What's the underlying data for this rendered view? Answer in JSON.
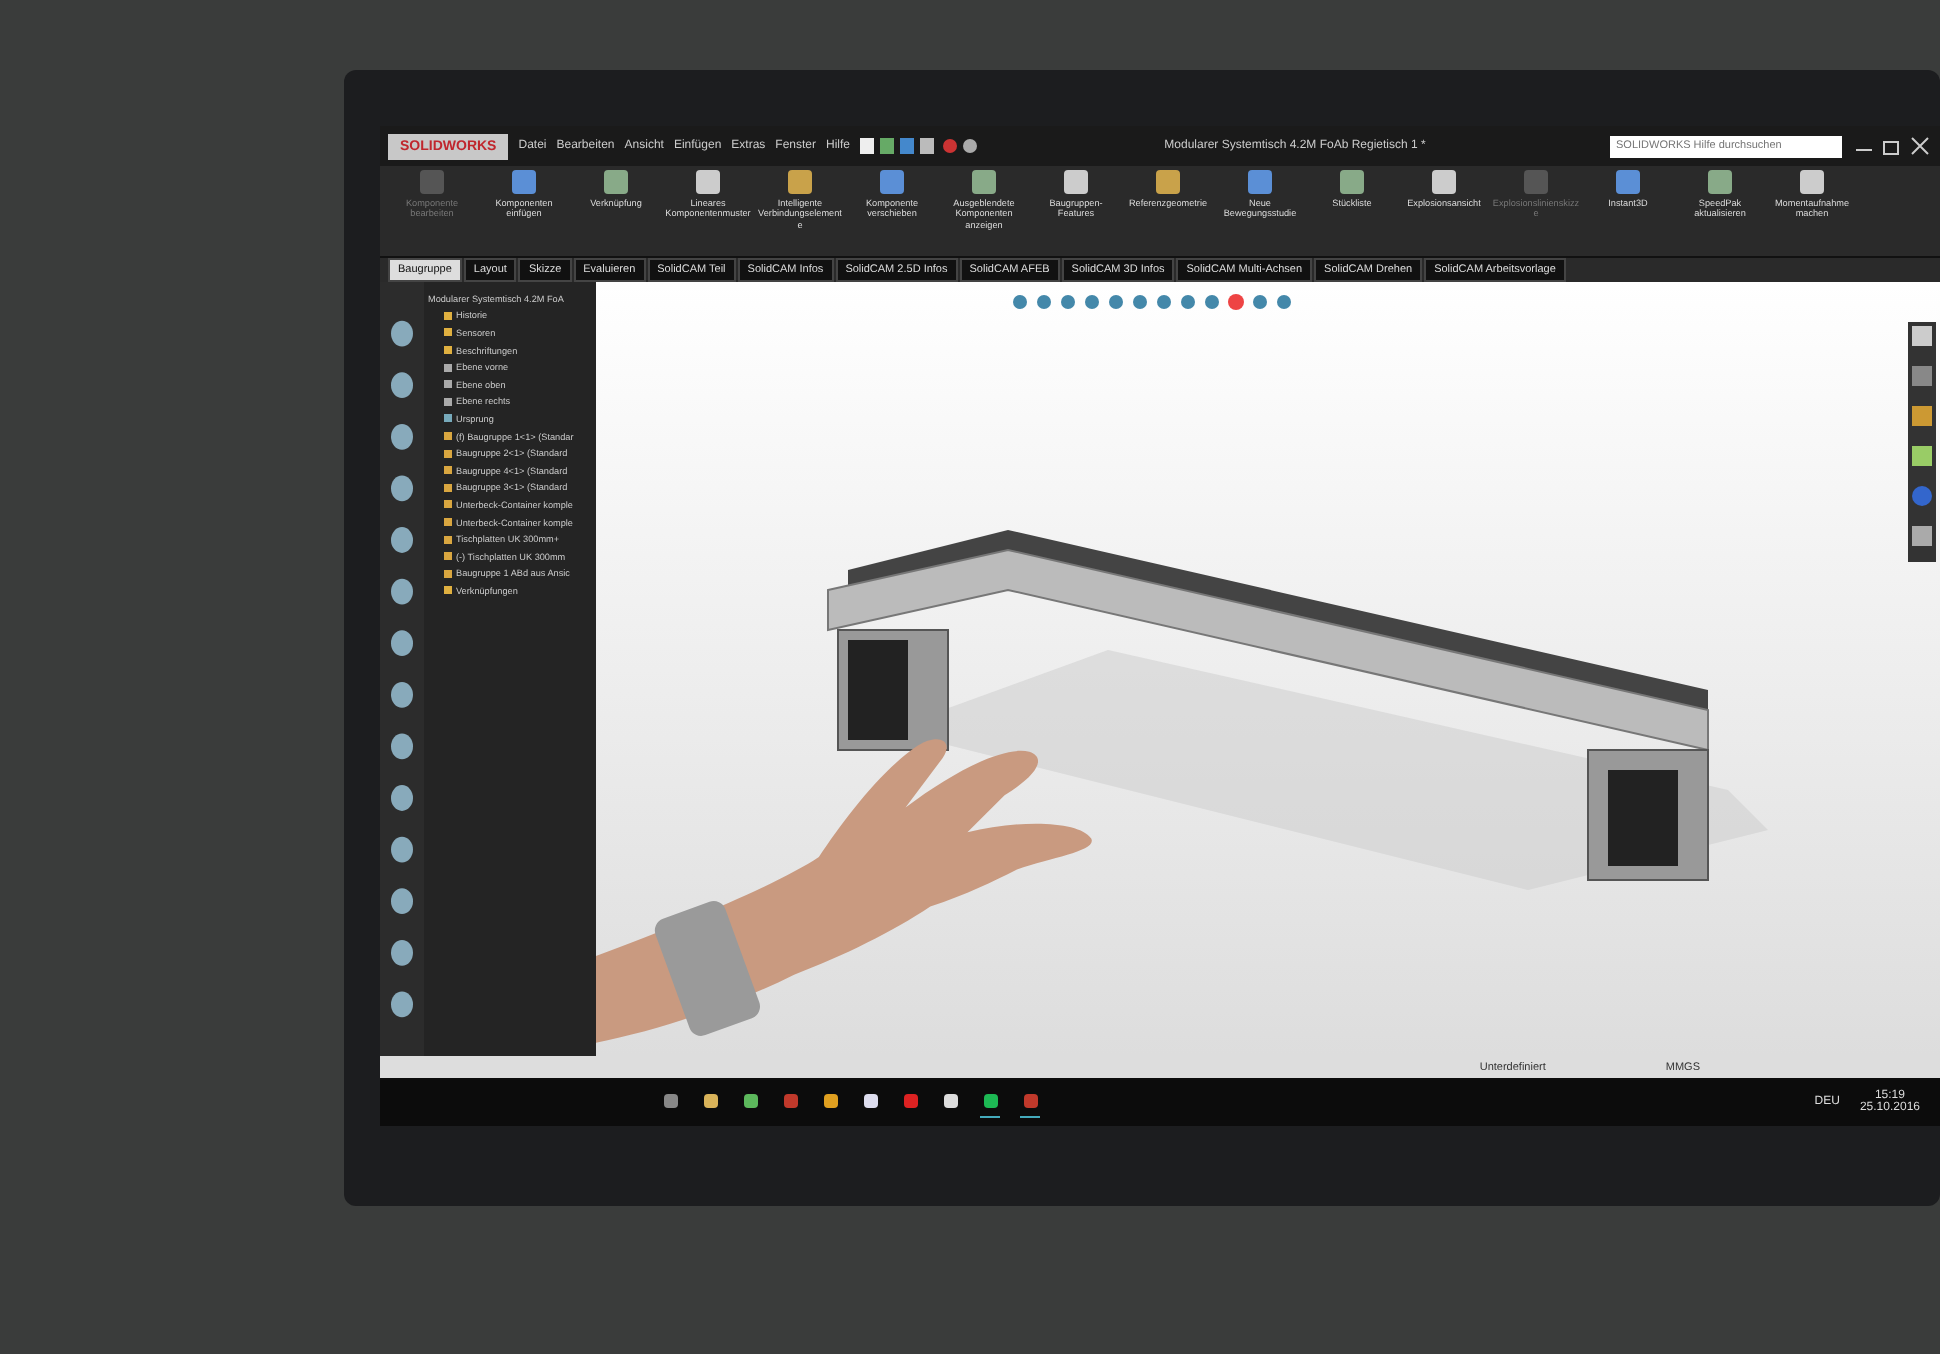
{
  "app": {
    "logo": "SOLIDWORKS",
    "menu": [
      "Datei",
      "Bearbeiten",
      "Ansicht",
      "Einfügen",
      "Extras",
      "Fenster",
      "Hilfe"
    ],
    "title": "Modularer Systemtisch 4.2M FoAb Regietisch 1 *",
    "search": {
      "placeholder": "SOLIDWORKS Hilfe durchsuchen"
    }
  },
  "ribbon": [
    {
      "label": "Komponente bearbeiten",
      "disabled": true
    },
    {
      "label": "Komponenten einfügen",
      "disabled": false
    },
    {
      "label": "Verknüpfung",
      "disabled": false
    },
    {
      "label": "Lineares Komponentenmuster",
      "disabled": false
    },
    {
      "label": "Intelligente Verbindungselemente",
      "disabled": false
    },
    {
      "label": "Komponente verschieben",
      "disabled": false
    },
    {
      "label": "Ausgeblendete Komponenten anzeigen",
      "disabled": false
    },
    {
      "label": "Baugruppen-Features",
      "disabled": false
    },
    {
      "label": "Referenzgeometrie",
      "disabled": false
    },
    {
      "label": "Neue Bewegungsstudie",
      "disabled": false
    },
    {
      "label": "Stückliste",
      "disabled": false
    },
    {
      "label": "Explosionsansicht",
      "disabled": false
    },
    {
      "label": "Explosionslinienskizze",
      "disabled": true
    },
    {
      "label": "Instant3D",
      "disabled": false
    },
    {
      "label": "SpeedPak aktualisieren",
      "disabled": false
    },
    {
      "label": "Momentaufnahme machen",
      "disabled": false
    }
  ],
  "tabs": [
    {
      "label": "Baugruppe",
      "selected": true
    },
    {
      "label": "Layout",
      "selected": false
    },
    {
      "label": "Skizze",
      "selected": false
    },
    {
      "label": "Evaluieren",
      "selected": false
    },
    {
      "label": "SolidCAM Teil",
      "selected": false
    },
    {
      "label": "SolidCAM Infos",
      "selected": false
    },
    {
      "label": "SolidCAM 2.5D Infos",
      "selected": false
    },
    {
      "label": "SolidCAM AFEB",
      "selected": false
    },
    {
      "label": "SolidCAM 3D Infos",
      "selected": false
    },
    {
      "label": "SolidCAM Multi-Achsen",
      "selected": false
    },
    {
      "label": "SolidCAM Drehen",
      "selected": false
    },
    {
      "label": "SolidCAM Arbeitsvorlage",
      "selected": false
    }
  ],
  "tree": {
    "root": "Modularer Systemtisch 4.2M FoA",
    "children": [
      {
        "label": "Historie",
        "kind": "folder"
      },
      {
        "label": "Sensoren",
        "kind": "folder"
      },
      {
        "label": "Beschriftungen",
        "kind": "folder"
      },
      {
        "label": "Ebene vorne",
        "kind": "plane"
      },
      {
        "label": "Ebene oben",
        "kind": "plane"
      },
      {
        "label": "Ebene rechts",
        "kind": "plane"
      },
      {
        "label": "Ursprung",
        "kind": "origin"
      },
      {
        "label": "(f) Baugruppe 1<1> (Standar",
        "kind": "part"
      },
      {
        "label": "Baugruppe 2<1> (Standard",
        "kind": "part"
      },
      {
        "label": "Baugruppe 4<1> (Standard",
        "kind": "part"
      },
      {
        "label": "Baugruppe 3<1> (Standard",
        "kind": "part"
      },
      {
        "label": "Unterbeck-Container komple",
        "kind": "part"
      },
      {
        "label": "Unterbeck-Container komple",
        "kind": "part"
      },
      {
        "label": "Tischplatten UK 300mm+",
        "kind": "part"
      },
      {
        "label": "(-) Tischplatten UK 300mm",
        "kind": "part"
      },
      {
        "label": "Baugruppe 1 ABd aus Ansic",
        "kind": "part"
      },
      {
        "label": "Verknüpfungen",
        "kind": "folder"
      }
    ]
  },
  "status": {
    "state": "Unterdefiniert",
    "units": "MMGS"
  },
  "taskbar": {
    "apps": [
      {
        "active": false
      },
      {
        "active": false
      },
      {
        "active": false
      },
      {
        "active": false
      },
      {
        "active": false
      },
      {
        "active": false
      },
      {
        "active": false
      },
      {
        "active": false
      },
      {
        "active": true
      },
      {
        "active": true
      }
    ],
    "language": "DEU",
    "time": "15:19",
    "date": "25.10.2016"
  }
}
